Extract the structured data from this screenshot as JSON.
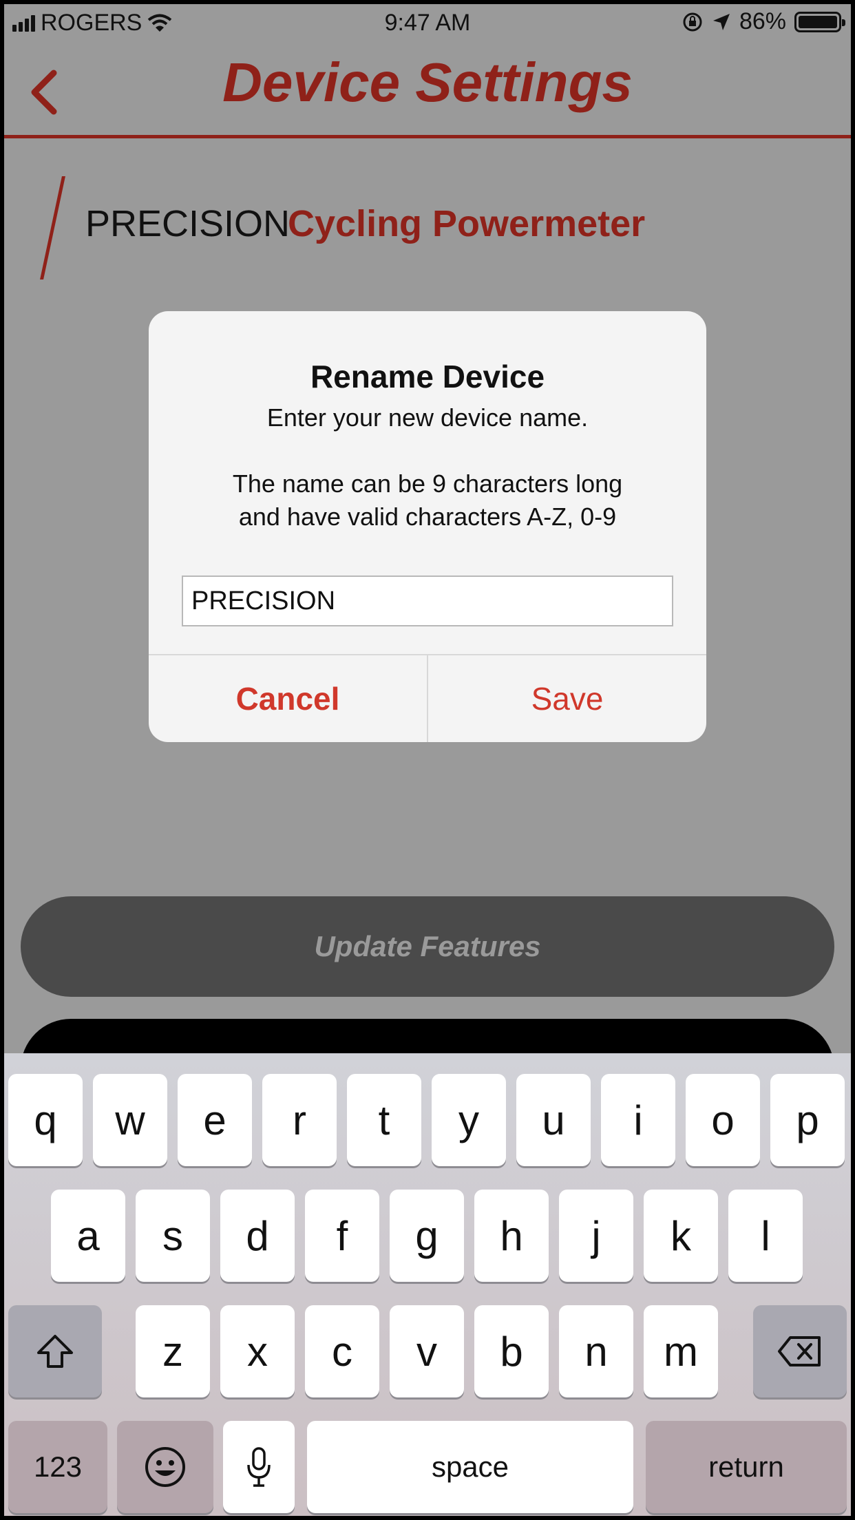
{
  "status_bar": {
    "carrier": "ROGERS",
    "time": "9:47 AM",
    "battery": "86%",
    "icons": [
      "signal-icon",
      "wifi-icon",
      "orientation-lock-icon",
      "location-icon",
      "battery-icon"
    ]
  },
  "header": {
    "title": "Device Settings",
    "back_icon": "chevron-left-icon"
  },
  "device": {
    "brand": "PRECISION",
    "product": "Cycling Powermeter"
  },
  "background_buttons": {
    "update": "Update Features"
  },
  "dialog": {
    "title": "Rename Device",
    "message_line1": "Enter your new device name.",
    "message_line2": "The name can be 9 characters long",
    "message_line3": "and have valid characters A-Z, 0-9",
    "input_value": "PRECISION",
    "cancel": "Cancel",
    "save": "Save"
  },
  "keyboard": {
    "row1": [
      "q",
      "w",
      "e",
      "r",
      "t",
      "y",
      "u",
      "i",
      "o",
      "p"
    ],
    "row2": [
      "a",
      "s",
      "d",
      "f",
      "g",
      "h",
      "j",
      "k",
      "l"
    ],
    "row3": [
      "z",
      "x",
      "c",
      "v",
      "b",
      "n",
      "m"
    ],
    "numbers": "123",
    "space": "space",
    "return": "return"
  },
  "colors": {
    "brand_red": "#8f2119",
    "action_red": "#d0382b",
    "overlay_gray": "#9a9a9a"
  }
}
